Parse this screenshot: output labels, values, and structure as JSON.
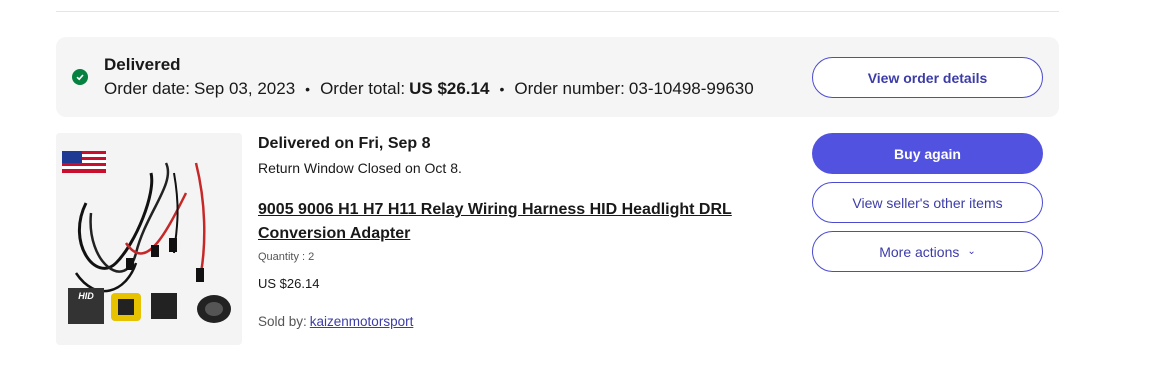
{
  "banner": {
    "status": "Delivered",
    "order_date_label": "Order date:",
    "order_date": "Sep 03, 2023",
    "order_total_label": "Order total:",
    "order_total": "US $26.14",
    "order_number_label": "Order number:",
    "order_number": "03-10498-99630",
    "view_details_label": "View order details",
    "status_icon": "check-circle-icon",
    "status_color": "#05823f"
  },
  "item": {
    "delivered_on": "Delivered on Fri, Sep 8",
    "return_window": "Return Window Closed on Oct 8.",
    "title": "9005 9006 H1 H7 H11 Relay Wiring Harness HID Headlight DRL Conversion Adapter",
    "quantity": "Quantity : 2",
    "price": "US $26.14",
    "sold_by_label": "Sold by:",
    "seller": "kaizenmotorsport",
    "thumb_badge": "HID"
  },
  "actions": {
    "buy_again": "Buy again",
    "view_seller_items": "View seller's other items",
    "more_actions": "More actions",
    "primary_color": "#5252e0"
  }
}
